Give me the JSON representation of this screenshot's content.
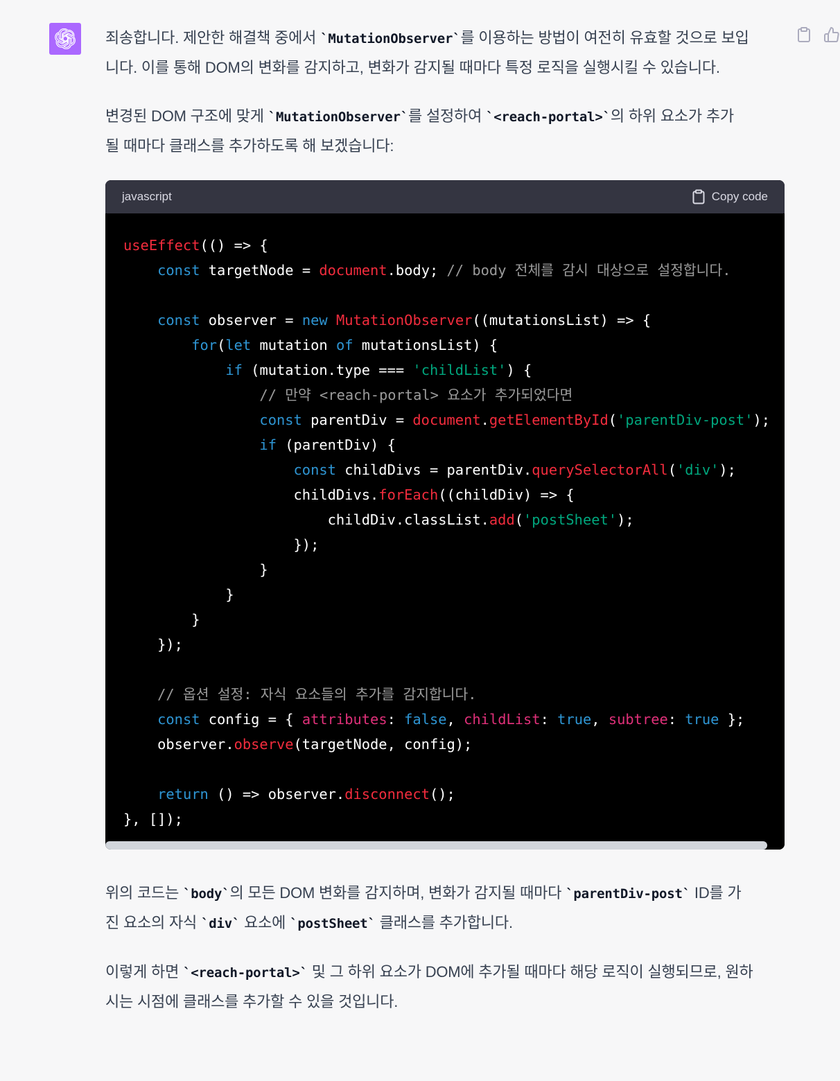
{
  "message": {
    "intro": [
      "죄송합니다. 제안한 해결책 중에서 ",
      "`MutationObserver`",
      "를 이용하는 방법이 여전히 유효할 것으로 보입",
      "니다. 이를 통해 DOM의 변화를 감지하고, 변화가 감지될 때마다 특정 로직을 실행시킬 수 있습니다."
    ],
    "setup": [
      "변경된 DOM 구조에 맞게 ",
      "`MutationObserver`",
      "를 설정하여 ",
      "`<reach-portal>`",
      "의 하위 요소가 추가",
      "될 때마다 클래스를 추가하도록 해 보겠습니다:"
    ],
    "explain": [
      "위의 코드는 ",
      "`body`",
      "의 모든 DOM 변화를 감지하며, 변화가 감지될 때마다 ",
      "`parentDiv-post`",
      " ID를 가",
      "진 요소의 자식 ",
      "`div`",
      " 요소에 ",
      "`postSheet`",
      " 클래스를 추가합니다."
    ],
    "conclusion": [
      "이렇게 하면 ",
      "`<reach-portal>`",
      " 및 그 하위 요소가 DOM에 추가될 때마다 해당 로직이 실행되므로, 원하",
      "시는 시점에 클래스를 추가할 수 있을 것입니다."
    ]
  },
  "code_block": {
    "language": "javascript",
    "copy_label": "Copy code",
    "lines": [
      [
        [
          "fn",
          "useEffect"
        ],
        [
          "p",
          "(() => {"
        ]
      ],
      [
        [
          "p",
          "    "
        ],
        [
          "kw",
          "const"
        ],
        [
          "p",
          " targetNode = "
        ],
        [
          "fn",
          "document"
        ],
        [
          "p",
          ".body; "
        ],
        [
          "cm",
          "// body 전체를 감시 대상으로 설정합니다."
        ]
      ],
      [
        [
          "p",
          ""
        ]
      ],
      [
        [
          "p",
          "    "
        ],
        [
          "kw",
          "const"
        ],
        [
          "p",
          " observer = "
        ],
        [
          "kw",
          "new"
        ],
        [
          "p",
          " "
        ],
        [
          "fn",
          "MutationObserver"
        ],
        [
          "p",
          "((mutationsList) => {"
        ]
      ],
      [
        [
          "p",
          "        "
        ],
        [
          "kw",
          "for"
        ],
        [
          "p",
          "("
        ],
        [
          "kw",
          "let"
        ],
        [
          "p",
          " mutation "
        ],
        [
          "kw",
          "of"
        ],
        [
          "p",
          " mutationsList) {"
        ]
      ],
      [
        [
          "p",
          "            "
        ],
        [
          "kw",
          "if"
        ],
        [
          "p",
          " (mutation.type === "
        ],
        [
          "str",
          "'childList'"
        ],
        [
          "p",
          ") {"
        ]
      ],
      [
        [
          "p",
          "                "
        ],
        [
          "cm",
          "// 만약 <reach-portal> 요소가 추가되었다면"
        ]
      ],
      [
        [
          "p",
          "                "
        ],
        [
          "kw",
          "const"
        ],
        [
          "p",
          " parentDiv = "
        ],
        [
          "fn",
          "document"
        ],
        [
          "p",
          "."
        ],
        [
          "fn",
          "getElementById"
        ],
        [
          "p",
          "("
        ],
        [
          "str",
          "'parentDiv-post'"
        ],
        [
          "p",
          ");"
        ]
      ],
      [
        [
          "p",
          "                "
        ],
        [
          "kw",
          "if"
        ],
        [
          "p",
          " (parentDiv) {"
        ]
      ],
      [
        [
          "p",
          "                    "
        ],
        [
          "kw",
          "const"
        ],
        [
          "p",
          " childDivs = parentDiv."
        ],
        [
          "fn",
          "querySelectorAll"
        ],
        [
          "p",
          "("
        ],
        [
          "str",
          "'div'"
        ],
        [
          "p",
          ");"
        ]
      ],
      [
        [
          "p",
          "                    childDivs."
        ],
        [
          "fn",
          "forEach"
        ],
        [
          "p",
          "((childDiv) => {"
        ]
      ],
      [
        [
          "p",
          "                        childDiv.classList."
        ],
        [
          "fn",
          "add"
        ],
        [
          "p",
          "("
        ],
        [
          "str",
          "'postSheet'"
        ],
        [
          "p",
          ");"
        ]
      ],
      [
        [
          "p",
          "                    });"
        ]
      ],
      [
        [
          "p",
          "                }"
        ]
      ],
      [
        [
          "p",
          "            }"
        ]
      ],
      [
        [
          "p",
          "        }"
        ]
      ],
      [
        [
          "p",
          "    });"
        ]
      ],
      [
        [
          "p",
          ""
        ]
      ],
      [
        [
          "p",
          "    "
        ],
        [
          "cm",
          "// 옵션 설정: 자식 요소들의 추가를 감지합니다."
        ]
      ],
      [
        [
          "p",
          "    "
        ],
        [
          "kw",
          "const"
        ],
        [
          "p",
          " config = { "
        ],
        [
          "prop",
          "attributes"
        ],
        [
          "p",
          ": "
        ],
        [
          "kw",
          "false"
        ],
        [
          "p",
          ", "
        ],
        [
          "prop",
          "childList"
        ],
        [
          "p",
          ": "
        ],
        [
          "kw",
          "true"
        ],
        [
          "p",
          ", "
        ],
        [
          "prop",
          "subtree"
        ],
        [
          "p",
          ": "
        ],
        [
          "kw",
          "true"
        ],
        [
          "p",
          " };"
        ]
      ],
      [
        [
          "p",
          "    observer."
        ],
        [
          "fn",
          "observe"
        ],
        [
          "p",
          "(targetNode, config);"
        ]
      ],
      [
        [
          "p",
          ""
        ]
      ],
      [
        [
          "p",
          "    "
        ],
        [
          "kw",
          "return"
        ],
        [
          "p",
          " () => observer."
        ],
        [
          "fn",
          "disconnect"
        ],
        [
          "p",
          "();"
        ]
      ],
      [
        [
          "p",
          "}, []);"
        ]
      ]
    ]
  },
  "colors": {
    "page_bg": "#f7f7f8",
    "avatar_bg": "#ab68ff",
    "code_bg": "#000000",
    "code_header_bg": "#343541",
    "function": "#f22c3d",
    "keyword": "#2e95d3",
    "string": "#00a67d",
    "comment": "#9b9b9b",
    "property": "#df3079"
  },
  "icons": {
    "avatar": "openai-logo-icon",
    "copy": "clipboard-icon",
    "like": "thumbs-up-icon"
  }
}
